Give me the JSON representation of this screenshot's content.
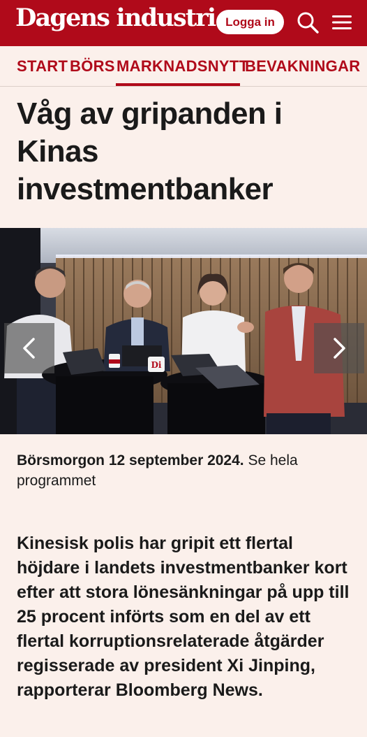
{
  "header": {
    "brand": "Dagens industri",
    "login_label": "Logga in",
    "search_icon": "search-icon",
    "menu_icon": "hamburger-menu-icon",
    "brand_color": "#b00a1a"
  },
  "nav": {
    "items": [
      {
        "label": "START"
      },
      {
        "label": "BÖRS"
      },
      {
        "label": "MARKNADSNYTT",
        "active": true
      },
      {
        "label": "BEVAKNINGAR"
      }
    ]
  },
  "article": {
    "headline": "Våg av gripanden i Kinas investmentbanker",
    "media": {
      "prev_icon": "chevron-left-icon",
      "next_icon": "chevron-right-icon",
      "mug_logo": "Di"
    },
    "caption": {
      "strong": "Börsmorgon 12 september 2024.",
      "link": "Se hela programmet"
    },
    "lead": "Kinesisk polis har gripit ett flertal höjdare i landets investmentbanker kort efter att stora lönesänkningar på upp till 25 procent införts som en del av ett flertal korruptionsrelaterade åtgärder regisserade av president Xi Jinping, rapporterar Bloomberg News."
  }
}
